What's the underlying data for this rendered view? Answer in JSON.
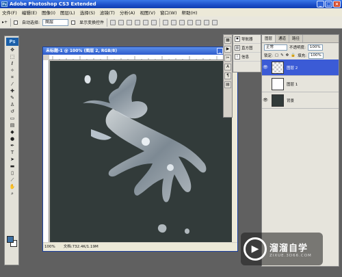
{
  "app": {
    "title": "Adobe Photoshop CS3 Extended"
  },
  "menu": [
    "文件(F)",
    "编辑(E)",
    "图像(I)",
    "图层(L)",
    "选择(S)",
    "滤镜(T)",
    "分析(A)",
    "视图(V)",
    "窗口(W)",
    "帮助(H)"
  ],
  "options": {
    "auto_select_label": "自动选择:",
    "auto_select_value": "图层",
    "transform_label": "显示变换控件"
  },
  "toolbox": {
    "logo": "Ps"
  },
  "document": {
    "title": "未标题-1 @ 100% (图层 2, RGB/8)",
    "zoom": "100%",
    "doc_info": "文档:732.4K/1.19M"
  },
  "navigator": {
    "items": [
      {
        "label": "导航器"
      },
      {
        "label": "直方图"
      },
      {
        "label": "信息"
      }
    ]
  },
  "layers": {
    "tabs": [
      "图层",
      "通道",
      "路径"
    ],
    "blend_mode": "正常",
    "opacity_label": "不透明度:",
    "opacity_value": "100%",
    "lock_label": "锁定:",
    "fill_label": "填充:",
    "fill_value": "100%",
    "list": [
      {
        "name": "图层 2",
        "selected": true
      },
      {
        "name": "图层 1",
        "selected": false
      },
      {
        "name": "背景",
        "selected": false
      }
    ]
  },
  "watermark": {
    "brand": "溜溜自学",
    "url": "ZIXUE.3D66.COM"
  }
}
